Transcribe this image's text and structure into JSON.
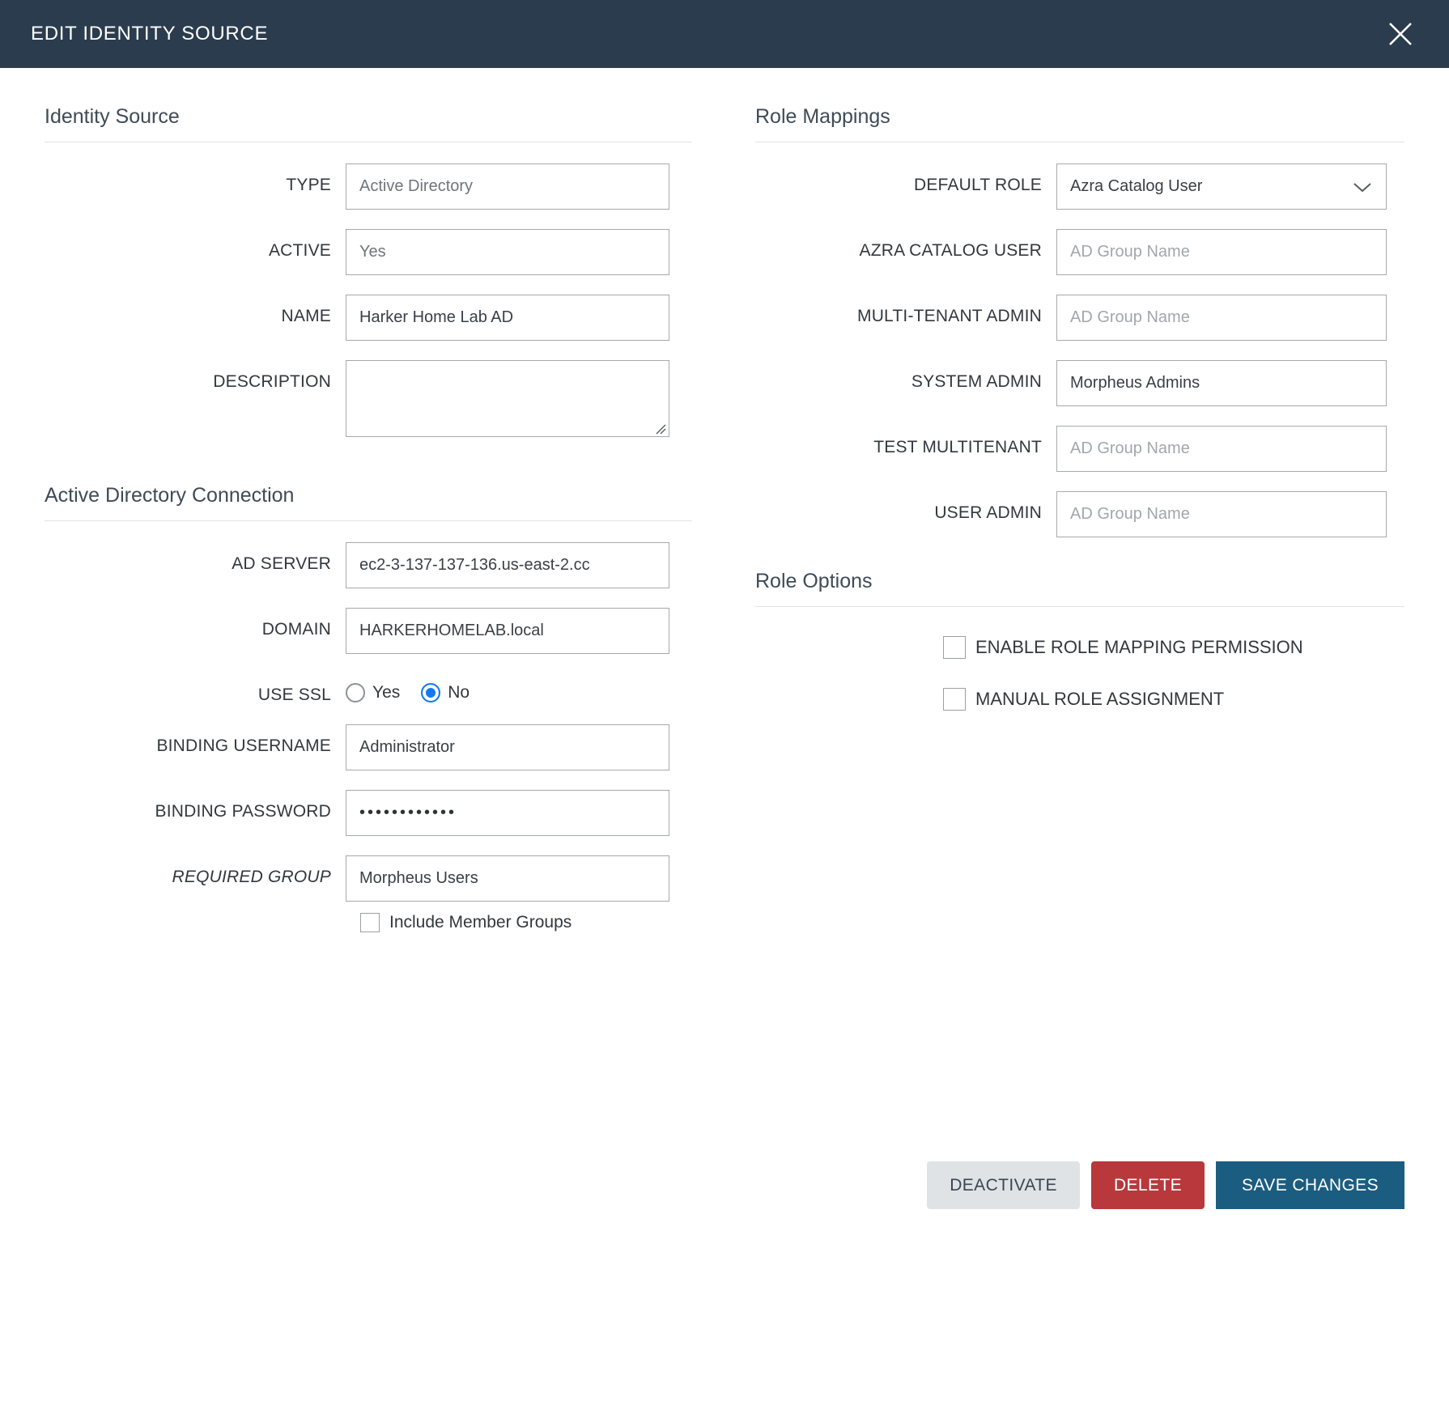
{
  "header": {
    "title": "EDIT IDENTITY SOURCE",
    "close_icon": "close-icon"
  },
  "identity_source": {
    "heading": "Identity Source",
    "fields": {
      "type": {
        "label": "TYPE",
        "value": "Active Directory"
      },
      "active": {
        "label": "ACTIVE",
        "value": "Yes"
      },
      "name": {
        "label": "NAME",
        "value": "Harker Home Lab AD"
      },
      "description": {
        "label": "DESCRIPTION",
        "value": ""
      }
    }
  },
  "ad_connection": {
    "heading": "Active Directory Connection",
    "fields": {
      "ad_server": {
        "label": "AD SERVER",
        "value": "ec2-3-137-137-136.us-east-2.cc"
      },
      "domain": {
        "label": "DOMAIN",
        "value": "HARKERHOMELAB.local"
      },
      "use_ssl": {
        "label": "USE SSL",
        "options": [
          {
            "label": "Yes",
            "selected": false
          },
          {
            "label": "No",
            "selected": true
          }
        ]
      },
      "binding_username": {
        "label": "BINDING USERNAME",
        "value": "Administrator"
      },
      "binding_password": {
        "label": "BINDING PASSWORD",
        "value": "••••••••••••"
      },
      "required_group": {
        "label": "REQUIRED GROUP",
        "value": "Morpheus Users"
      },
      "include_member_groups": {
        "label": "Include Member Groups",
        "checked": false
      }
    }
  },
  "role_mappings": {
    "heading": "Role Mappings",
    "default_role": {
      "label": "DEFAULT ROLE",
      "value": "Azra Catalog User",
      "chevron_icon": "chevron-down-icon"
    },
    "placeholder": "AD Group Name",
    "rows": [
      {
        "label": "AZRA CATALOG USER",
        "value": ""
      },
      {
        "label": "MULTI-TENANT ADMIN",
        "value": ""
      },
      {
        "label": "SYSTEM ADMIN",
        "value": "Morpheus Admins"
      },
      {
        "label": "TEST MULTITENANT",
        "value": ""
      },
      {
        "label": "USER ADMIN",
        "value": ""
      }
    ]
  },
  "role_options": {
    "heading": "Role Options",
    "items": [
      {
        "label": "ENABLE ROLE MAPPING PERMISSION",
        "checked": false
      },
      {
        "label": "MANUAL ROLE ASSIGNMENT",
        "checked": false
      }
    ]
  },
  "footer": {
    "deactivate_label": "DEACTIVATE",
    "delete_label": "DELETE",
    "save_label": "SAVE CHANGES"
  },
  "colors": {
    "header_bg": "#2b3c4e",
    "accent_blue": "#1479f0",
    "delete_red": "#b8383b",
    "save_blue": "#1b5d80",
    "deactivate_grey": "#dfe3e6"
  }
}
